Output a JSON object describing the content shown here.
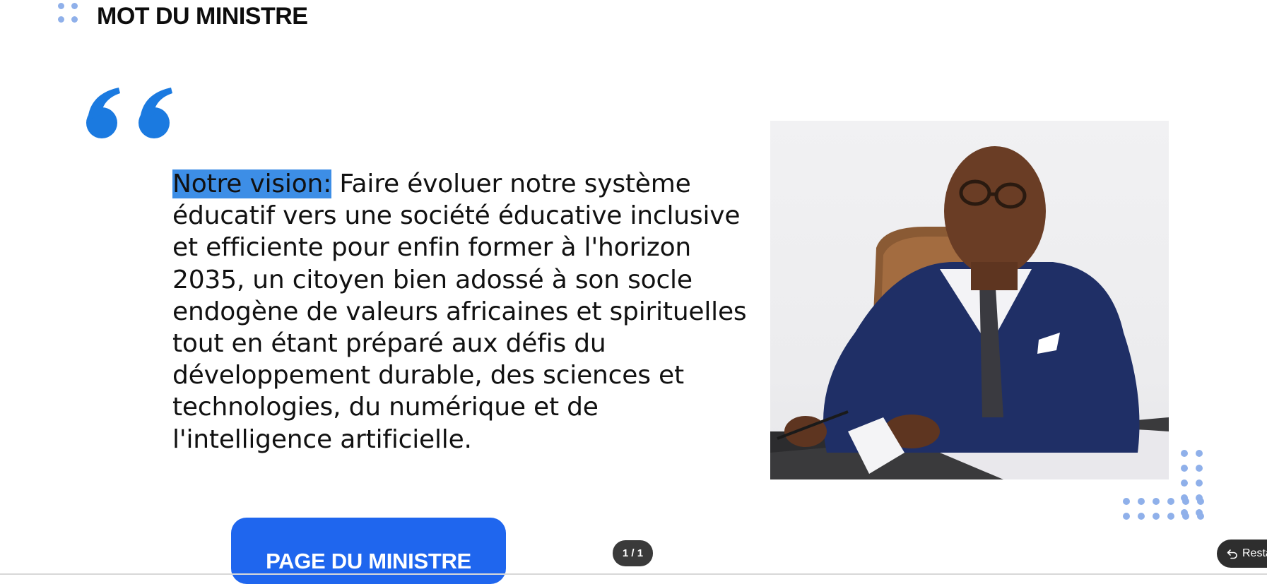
{
  "header": {
    "title": "MOT DU MINISTRE"
  },
  "quote": {
    "highlight": "Notre vision:",
    "text": " Faire évoluer notre système éducatif vers une société éducative inclusive et efficiente pour enfin former à l'horizon 2035, un citoyen bien adossé à son socle endogène de valeurs africaines et spirituelles tout en étant préparé aux défis du développement durable, des sciences et technologies, du numérique et de l'intelligence artificielle."
  },
  "cta": {
    "label": "PAGE DU MINISTRE"
  },
  "pager": {
    "label": "1 / 1"
  },
  "restore": {
    "label": "Resta"
  },
  "colors": {
    "accent": "#1f66ee",
    "quote_mark": "#1b7ae0",
    "dots": "#8fb0ea",
    "highlight": "#3d8ee6"
  },
  "icons": {
    "quote": "double-quote-icon",
    "restore": "undo-arrow-icon"
  }
}
